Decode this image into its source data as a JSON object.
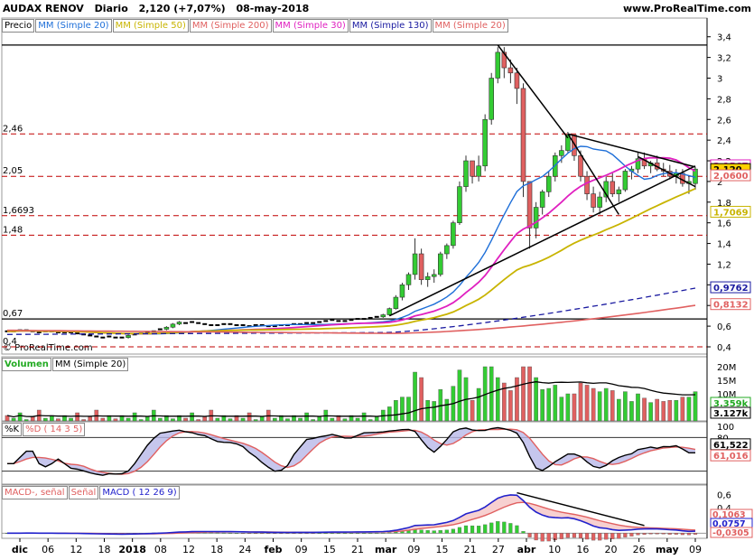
{
  "header": {
    "symbol": "AUDAX RENOV",
    "period": "Diario",
    "price_change": "2,120 (+7,07%)",
    "date": "08-may-2018",
    "site": "www.ProRealTime.com",
    "copyright": "© ProRealTime.com"
  },
  "legend_price": [
    {
      "label": "Precio",
      "color": "#000000"
    },
    {
      "label": "MM (Simple 20)",
      "color": "#1e6fd8"
    },
    {
      "label": "MM (Simple 50)",
      "color": "#c8b400"
    },
    {
      "label": "MM (Simple 200)",
      "color": "#e06060"
    },
    {
      "label": "MM (Simple 30)",
      "color": "#e020c0"
    },
    {
      "label": "MM (Simple 130)",
      "color": "#1a1aa0"
    },
    {
      "label": "MM (Simple 20)",
      "color": "#e06060"
    }
  ],
  "legend_volume": [
    {
      "label": "Volumen",
      "color": "#22aa22"
    },
    {
      "label": "MM (Simple 20)",
      "color": "#000000"
    }
  ],
  "legend_stoch": [
    {
      "label": "%K",
      "color": "#000000"
    },
    {
      "label": "%D ( 14 3 5)",
      "color": "#e06060"
    }
  ],
  "legend_macd": [
    {
      "label": "MACD-, señal",
      "color": "#e06060"
    },
    {
      "label": "Señal",
      "color": "#e06060"
    },
    {
      "label": "MACD ( 12 26 9)",
      "color": "#2222cc"
    }
  ],
  "chart_data": [
    {
      "type": "candlestick",
      "title": "AUDAX RENOV Diario",
      "ylim": [
        0.33,
        3.45
      ],
      "y_ticks": [
        "3,4",
        "3,2",
        "3",
        "2,8",
        "2,6",
        "2,4",
        "2,2",
        "2",
        "1,8",
        "1,6",
        "1,4",
        "1,2",
        "1",
        "0,8",
        "0,6",
        "0,4"
      ],
      "x_ticks": [
        "dic",
        "06",
        "12",
        "18",
        "2018",
        "08",
        "12",
        "18",
        "24",
        "feb",
        "09",
        "15",
        "21",
        "mar",
        "09",
        "15",
        "21",
        "27",
        "abr",
        "10",
        "16",
        "20",
        "26",
        "may",
        "09"
      ],
      "horizontal_levels": [
        {
          "label": "2,46",
          "value": 2.46
        },
        {
          "label": "2,05",
          "value": 2.05
        },
        {
          "label": "1,6693",
          "value": 1.6693
        },
        {
          "label": "1,48",
          "value": 1.48
        },
        {
          "label": "0,67",
          "value": 0.67
        },
        {
          "label": "0,4",
          "value": 0.4
        }
      ],
      "last_values": [
        {
          "label": "2,1567",
          "value": 2.1567,
          "color": "#e020c0"
        },
        {
          "label": "2,120",
          "value": 2.12,
          "color": "#000000"
        },
        {
          "label": "2,0600",
          "value": 2.06,
          "color": "#e06060"
        },
        {
          "label": "1,7069",
          "value": 1.7069,
          "color": "#c8b400"
        },
        {
          "label": "0,9762",
          "value": 0.9762,
          "color": "#1a1aa0"
        },
        {
          "label": "0,8132",
          "value": 0.8132,
          "color": "#e06060"
        }
      ],
      "candles": [
        [
          0.56,
          0.57,
          0.54,
          0.55
        ],
        [
          0.55,
          0.56,
          0.54,
          0.55
        ],
        [
          0.55,
          0.56,
          0.54,
          0.56
        ],
        [
          0.56,
          0.57,
          0.55,
          0.56
        ],
        [
          0.56,
          0.57,
          0.55,
          0.55
        ],
        [
          0.55,
          0.56,
          0.54,
          0.54
        ],
        [
          0.54,
          0.55,
          0.53,
          0.55
        ],
        [
          0.55,
          0.56,
          0.54,
          0.55
        ],
        [
          0.55,
          0.56,
          0.54,
          0.54
        ],
        [
          0.54,
          0.55,
          0.53,
          0.54
        ],
        [
          0.54,
          0.55,
          0.53,
          0.54
        ],
        [
          0.54,
          0.55,
          0.52,
          0.53
        ],
        [
          0.53,
          0.54,
          0.51,
          0.52
        ],
        [
          0.52,
          0.53,
          0.5,
          0.51
        ],
        [
          0.51,
          0.52,
          0.49,
          0.5
        ],
        [
          0.5,
          0.51,
          0.48,
          0.49
        ],
        [
          0.49,
          0.51,
          0.48,
          0.5
        ],
        [
          0.5,
          0.51,
          0.48,
          0.49
        ],
        [
          0.49,
          0.5,
          0.48,
          0.49
        ],
        [
          0.49,
          0.52,
          0.48,
          0.51
        ],
        [
          0.51,
          0.53,
          0.5,
          0.52
        ],
        [
          0.52,
          0.54,
          0.51,
          0.53
        ],
        [
          0.53,
          0.55,
          0.52,
          0.54
        ],
        [
          0.54,
          0.56,
          0.53,
          0.55
        ],
        [
          0.55,
          0.58,
          0.54,
          0.57
        ],
        [
          0.57,
          0.6,
          0.56,
          0.59
        ],
        [
          0.59,
          0.63,
          0.58,
          0.62
        ],
        [
          0.62,
          0.65,
          0.61,
          0.64
        ],
        [
          0.64,
          0.66,
          0.62,
          0.63
        ],
        [
          0.63,
          0.65,
          0.62,
          0.64
        ],
        [
          0.64,
          0.65,
          0.62,
          0.63
        ],
        [
          0.63,
          0.64,
          0.61,
          0.62
        ],
        [
          0.62,
          0.63,
          0.6,
          0.61
        ],
        [
          0.61,
          0.62,
          0.6,
          0.61
        ],
        [
          0.61,
          0.62,
          0.6,
          0.62
        ],
        [
          0.62,
          0.63,
          0.61,
          0.62
        ],
        [
          0.62,
          0.63,
          0.6,
          0.61
        ],
        [
          0.61,
          0.62,
          0.6,
          0.61
        ],
        [
          0.61,
          0.62,
          0.6,
          0.6
        ],
        [
          0.6,
          0.62,
          0.59,
          0.61
        ],
        [
          0.61,
          0.62,
          0.6,
          0.61
        ],
        [
          0.61,
          0.62,
          0.6,
          0.6
        ],
        [
          0.6,
          0.61,
          0.59,
          0.6
        ],
        [
          0.6,
          0.61,
          0.59,
          0.61
        ],
        [
          0.61,
          0.62,
          0.6,
          0.61
        ],
        [
          0.61,
          0.62,
          0.6,
          0.62
        ],
        [
          0.62,
          0.63,
          0.61,
          0.62
        ],
        [
          0.62,
          0.64,
          0.61,
          0.63
        ],
        [
          0.63,
          0.64,
          0.62,
          0.63
        ],
        [
          0.63,
          0.65,
          0.62,
          0.64
        ],
        [
          0.64,
          0.66,
          0.63,
          0.65
        ],
        [
          0.65,
          0.67,
          0.64,
          0.66
        ],
        [
          0.66,
          0.67,
          0.64,
          0.65
        ],
        [
          0.65,
          0.66,
          0.64,
          0.65
        ],
        [
          0.65,
          0.67,
          0.64,
          0.66
        ],
        [
          0.66,
          0.68,
          0.65,
          0.67
        ],
        [
          0.67,
          0.68,
          0.66,
          0.67
        ],
        [
          0.67,
          0.69,
          0.66,
          0.68
        ],
        [
          0.68,
          0.7,
          0.67,
          0.69
        ],
        [
          0.69,
          0.72,
          0.68,
          0.71
        ],
        [
          0.71,
          0.78,
          0.7,
          0.77
        ],
        [
          0.77,
          0.9,
          0.76,
          0.88
        ],
        [
          0.88,
          1.02,
          0.85,
          1.0
        ],
        [
          1.0,
          1.12,
          0.95,
          1.1
        ],
        [
          1.1,
          1.45,
          1.05,
          1.3
        ],
        [
          1.3,
          1.35,
          1.0,
          1.05
        ],
        [
          1.05,
          1.12,
          0.98,
          1.08
        ],
        [
          1.08,
          1.15,
          1.02,
          1.1
        ],
        [
          1.1,
          1.32,
          1.08,
          1.3
        ],
        [
          1.3,
          1.4,
          1.25,
          1.38
        ],
        [
          1.38,
          1.62,
          1.35,
          1.6
        ],
        [
          1.6,
          2.0,
          1.58,
          1.95
        ],
        [
          1.95,
          2.25,
          1.9,
          2.2
        ],
        [
          2.2,
          2.12,
          1.98,
          2.05
        ],
        [
          2.05,
          2.25,
          2.0,
          2.15
        ],
        [
          2.15,
          2.65,
          2.1,
          2.6
        ],
        [
          2.6,
          3.05,
          2.55,
          3.0
        ],
        [
          3.0,
          3.3,
          2.95,
          3.25
        ],
        [
          3.25,
          3.3,
          3.0,
          3.1
        ],
        [
          3.1,
          3.18,
          2.95,
          3.05
        ],
        [
          3.05,
          3.1,
          2.75,
          2.9
        ],
        [
          2.9,
          2.95,
          1.85,
          2.0
        ],
        [
          2.0,
          1.95,
          1.35,
          1.55
        ],
        [
          1.55,
          1.8,
          1.45,
          1.75
        ],
        [
          1.75,
          1.92,
          1.68,
          1.9
        ],
        [
          1.9,
          2.1,
          1.85,
          2.05
        ],
        [
          2.05,
          2.28,
          2.0,
          2.25
        ],
        [
          2.25,
          2.35,
          2.18,
          2.3
        ],
        [
          2.3,
          2.48,
          2.28,
          2.45
        ],
        [
          2.45,
          2.4,
          2.2,
          2.25
        ],
        [
          2.25,
          2.3,
          2.0,
          2.05
        ],
        [
          2.05,
          2.1,
          1.82,
          1.88
        ],
        [
          1.88,
          1.95,
          1.7,
          1.75
        ],
        [
          1.75,
          1.9,
          1.68,
          1.85
        ],
        [
          1.85,
          2.05,
          1.8,
          2.0
        ],
        [
          2.0,
          2.08,
          1.85,
          1.88
        ],
        [
          1.88,
          1.95,
          1.8,
          1.92
        ],
        [
          1.92,
          2.12,
          1.9,
          2.1
        ],
        [
          2.1,
          2.15,
          2.02,
          2.12
        ],
        [
          2.12,
          2.28,
          2.08,
          2.22
        ],
        [
          2.22,
          2.28,
          2.12,
          2.15
        ],
        [
          2.15,
          2.2,
          2.08,
          2.18
        ],
        [
          2.18,
          2.25,
          2.1,
          2.12
        ],
        [
          2.12,
          2.18,
          2.05,
          2.1
        ],
        [
          2.1,
          2.16,
          2.02,
          2.05
        ],
        [
          2.05,
          2.12,
          1.98,
          2.08
        ],
        [
          2.08,
          2.12,
          1.95,
          1.98
        ],
        [
          1.98,
          2.05,
          1.88,
          2.0
        ],
        [
          1.98,
          2.14,
          1.92,
          2.12
        ]
      ]
    },
    {
      "type": "bar",
      "title": "Volumen",
      "y_ticks": [
        "20M",
        "15M",
        "10M",
        "5M"
      ],
      "last_values": [
        {
          "label": "3.359k",
          "value": 3.359,
          "color": "#22aa22"
        },
        {
          "label": "3.127k",
          "value": 3.127,
          "color": "#000000"
        }
      ]
    },
    {
      "type": "line",
      "title": "%K %D ( 14 3 5)",
      "y_ticks": [
        "100",
        "80",
        "60",
        "40",
        "20",
        "0"
      ],
      "last_values": [
        {
          "label": "61,522",
          "value": 61.522,
          "color": "#000000"
        },
        {
          "label": "61,016",
          "value": 61.016,
          "color": "#e06060"
        }
      ]
    },
    {
      "type": "line",
      "title": "MACD ( 12 26 9)",
      "y_ticks": [
        "0,6",
        "0,4",
        "0,2",
        "0"
      ],
      "last_values": [
        {
          "label": "0,1063",
          "value": 0.1063,
          "color": "#e06060"
        },
        {
          "label": "0,0757",
          "value": 0.0757,
          "color": "#2222cc"
        },
        {
          "label": "-0,0305",
          "value": -0.0305,
          "color": "#e06060"
        }
      ]
    }
  ]
}
